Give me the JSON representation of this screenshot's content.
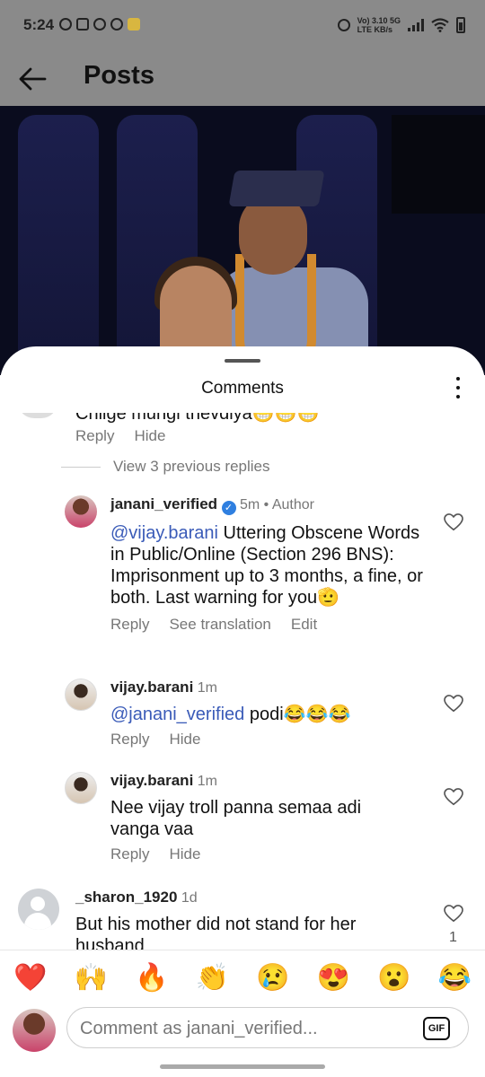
{
  "status": {
    "time": "5:24",
    "network_top": "Vo) 3.10 5G",
    "network_bottom": "LTE KB/s"
  },
  "header": {
    "title": "Posts",
    "back_icon": "arrow-left-icon"
  },
  "sheet": {
    "title": "Comments"
  },
  "cut_comment": {
    "text": "Chiige mungi thevdiya😁😁😁",
    "reply": "Reply",
    "hide": "Hide"
  },
  "view_previous": "View 3 previous replies",
  "comments": [
    {
      "username": "janani_verified",
      "time": "5m",
      "author_tag": "• Author",
      "mention": "@vijay.barani",
      "text": " Uttering Obscene Words in Public/Online (Section 296 BNS): Imprisonment up to 3 months, a fine, or both. Last warning for you🫡",
      "actions": [
        "Reply",
        "See translation",
        "Edit"
      ]
    },
    {
      "username": "vijay.barani",
      "time": "1m",
      "mention": "@janani_verified",
      "text": " podi😂😂😂",
      "actions": [
        "Reply",
        "Hide"
      ]
    },
    {
      "username": "vijay.barani",
      "time": "1m",
      "text": "Nee vijay troll panna semaa adi vanga vaa",
      "actions": [
        "Reply",
        "Hide"
      ]
    },
    {
      "username": "_sharon_1920",
      "time": "1d",
      "text": "But his mother did not stand for her husband",
      "likes": "1"
    }
  ],
  "emoji_bar": [
    "❤️",
    "🙌",
    "🔥",
    "👏",
    "😢",
    "😍",
    "😮",
    "😂"
  ],
  "composer": {
    "placeholder": "Comment as janani_verified...",
    "gif_label": "GIF"
  },
  "colors": {
    "mention": "#3a5bb8",
    "verified": "#2f7fe0",
    "overlay": "#8a8a8a"
  }
}
